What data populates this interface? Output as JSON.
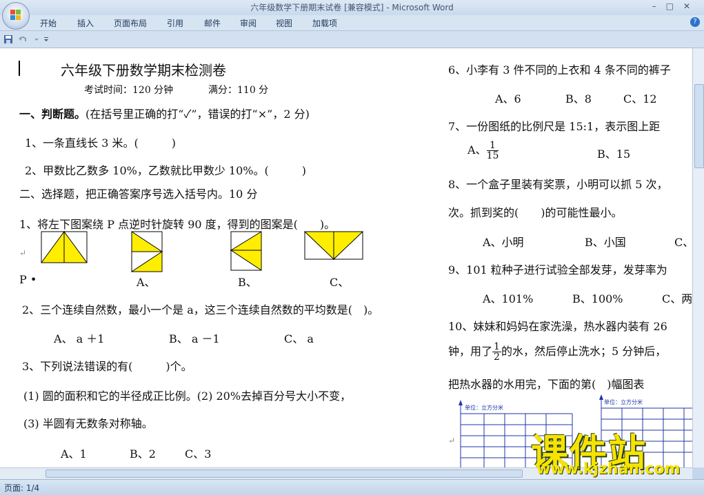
{
  "window": {
    "title": "六年级数学下册期末试卷 [兼容模式] - Microsoft Word"
  },
  "ribbon": {
    "tabs": [
      "开始",
      "插入",
      "页面布局",
      "引用",
      "邮件",
      "审阅",
      "视图",
      "加载项"
    ]
  },
  "status": {
    "page": "页面: 1/4"
  },
  "watermark": {
    "big": "课件站",
    "url": "www.kjzhan.com"
  },
  "doc": {
    "title": "六年级下册数学期末检测卷",
    "subtitle_time": "考试时间：120 分钟",
    "subtitle_score": "满分：110 分",
    "sec1_num": "一、",
    "sec1_head": "判断题。",
    "sec1_rest": "(在括号里正确的打“✓”，错误的打“×”，2 分)",
    "q1": "1、一条直线长 3 米。(　　　)",
    "q2": "2、甲数比乙数多 10%，乙数就比甲数少 10%。(　　　)",
    "sec2": "二、选择题，把正确答案序号选入括号内。10 分",
    "c1": "1、将左下图案绕 P 点逆时针旋转 90 度，得到的图案是(　　)。",
    "c1_label_p": "P",
    "c1_label_a": "A、",
    "c1_label_b": "B、",
    "c1_label_c": "C、",
    "c2": "2、三个连续自然数，最小一个是 a，这三个连续自然数的平均数是(　)。",
    "c2_a": "A、 a ＋1",
    "c2_b": "B、 a －1",
    "c2_c": "C、 a",
    "c3": "3、下列说法错误的有(　　　)个。",
    "c3_s1": "(1) 圆的面积和它的半径成正比例。(2) 20%去掉百分号大小不变，",
    "c3_s2": "(3) 半圆有无数条对称轴。",
    "c3_a": "A、1",
    "c3_b": "B、2",
    "c3_c": "C、3",
    "r6": "6、小李有 3 件不同的上衣和 4 条不同的裤子",
    "r6_a": "A、6",
    "r6_b": "B、8",
    "r6_c": "C、12",
    "r7": "7、一份图纸的比例尺是 15:1，表示图上距",
    "r7_a": "A、",
    "r7_a_num": "1",
    "r7_a_den": "15",
    "r7_b": "B、15",
    "r8": "8、一个盒子里装有奖票，小明可以抓 5 次，",
    "r8_cont": "次。抓到奖的(　　)的可能性最小。",
    "r8_a": "A、小明",
    "r8_b": "B、小国",
    "r8_c": "C、",
    "r9": "9、101 粒种子进行试验全部发芽，发芽率为",
    "r9_a": "A、101%",
    "r9_b": "B、100%",
    "r9_c": "C、两",
    "r10": "10、妹妹和妈妈在家洗澡，热水器内装有 26",
    "r10_cont_pre": "钟，用了",
    "r10_num": "1",
    "r10_den": "2",
    "r10_cont_post": "的水，然后停止洗水；5 分钟后，",
    "r10_cont2": "把热水器的水用完，下面的第(　)幅图表",
    "chart_unit": "单位：立方分米"
  },
  "colors": {
    "shape_fill": "#ffee00",
    "ribbon_text": "#1e395b",
    "grid_line": "#2233aa"
  }
}
